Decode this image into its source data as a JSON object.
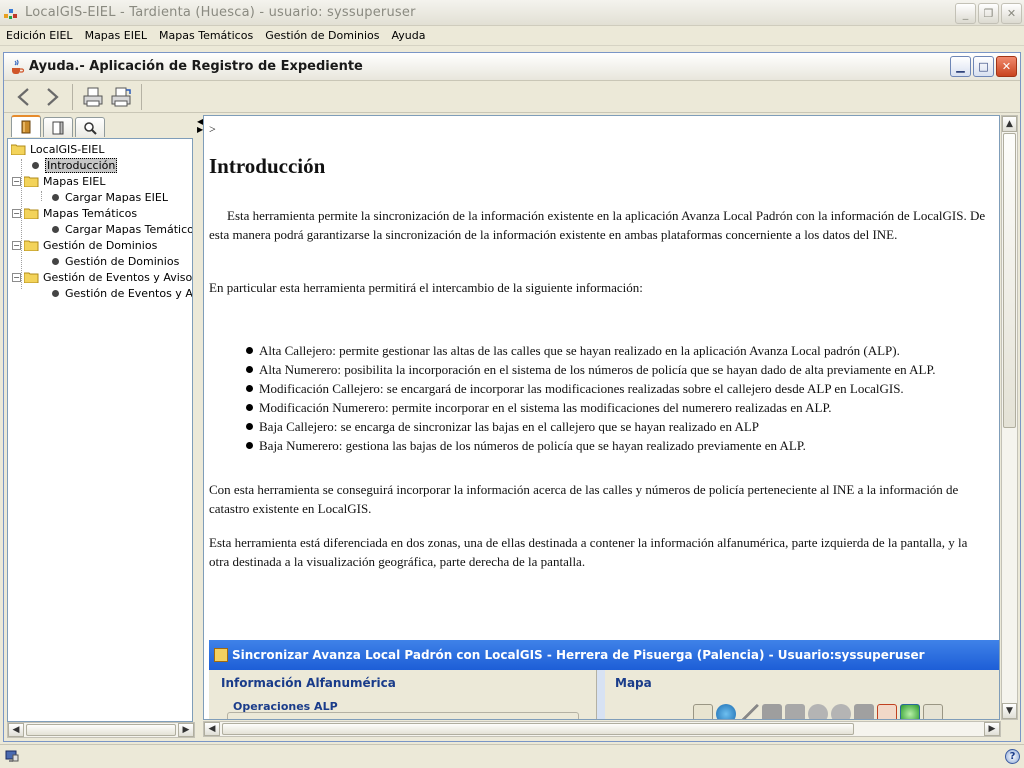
{
  "app": {
    "title": "LocalGIS-EIEL - Tardienta (Huesca) - usuario: syssuperuser",
    "menu": [
      "Edición EIEL",
      "Mapas EIEL",
      "Mapas Temáticos",
      "Gestión de Dominios",
      "Ayuda"
    ]
  },
  "help_window": {
    "title": "Ayuda.- Aplicación de Registro de Expediente",
    "toolbar": {
      "back_icon": "back-arrow-icon",
      "forward_icon": "forward-arrow-icon",
      "print_icon": "print-icon",
      "page_setup_icon": "page-setup-icon"
    },
    "nav_tabs": [
      "contents-tab",
      "index-tab",
      "search-tab"
    ],
    "tree": {
      "root": "LocalGIS-EIEL",
      "intro": "Introducción",
      "groups": [
        {
          "label": "Mapas EIEL",
          "child": "Cargar Mapas EIEL"
        },
        {
          "label": "Mapas Temáticos",
          "child": "Cargar Mapas Temáticos"
        },
        {
          "label": "Gestión de Dominios",
          "child": "Gestión de Dominios"
        },
        {
          "label": "Gestión de Eventos y Avisos",
          "child": "Gestión de Eventos y Avisos"
        }
      ]
    }
  },
  "content": {
    "crumb": ">",
    "heading": "Introducción",
    "para1": "Esta herramienta permite la sincronización de la información existente en la aplicación Avanza Local Padrón con la información de LocalGIS. De esta manera podrá garantizarse la sincronización de la información existente en ambas plataformas concerniente a los datos del INE.",
    "para2": "En particular esta herramienta permitirá el intercambio de la siguiente información:",
    "bullets": [
      "Alta Callejero: permite gestionar las altas de las calles que se hayan realizado en la aplicación Avanza Local padrón (ALP).",
      "Alta Numerero: posibilita la incorporación en el sistema de los números de policía que se hayan dado de alta previamente en ALP.",
      "Modificación Callejero: se encargará de incorporar las modificaciones realizadas sobre el callejero desde ALP en LocalGIS.",
      "Modificación Numerero: permite incorporar en el sistema las modificaciones del numerero realizadas en ALP.",
      "Baja Callejero: se encarga de sincronizar las bajas en el callejero que se hayan realizado en ALP",
      "Baja Numerero: gestiona las bajas de los números de policía que se hayan realizado previamente en ALP."
    ],
    "para3": "Con esta herramienta se conseguirá incorporar la información acerca de las calles y números de policía perteneciente al INE a la información de catastro existente en LocalGIS.",
    "para4": "Esta herramienta está diferenciada en dos zonas, una de ellas destinada a contener la información alfanumérica, parte izquierda de la pantalla, y la otra destinada a la visualización geográfica, parte derecha de la pantalla.",
    "embedded": {
      "title": "Sincronizar Avanza Local Padrón con LocalGIS - Herrera de Pisuerga (Palencia) - Usuario:syssuperuser",
      "left_panel": "Información Alfanumérica",
      "left_group": "Operaciones ALP",
      "right_panel": "Mapa"
    }
  },
  "colors": {
    "selection": "#c7c7c7",
    "embedded_titlebar": "#1d5ed7",
    "panel_heading": "#1a3c8a",
    "help_frame_border": "#7a96c6"
  }
}
